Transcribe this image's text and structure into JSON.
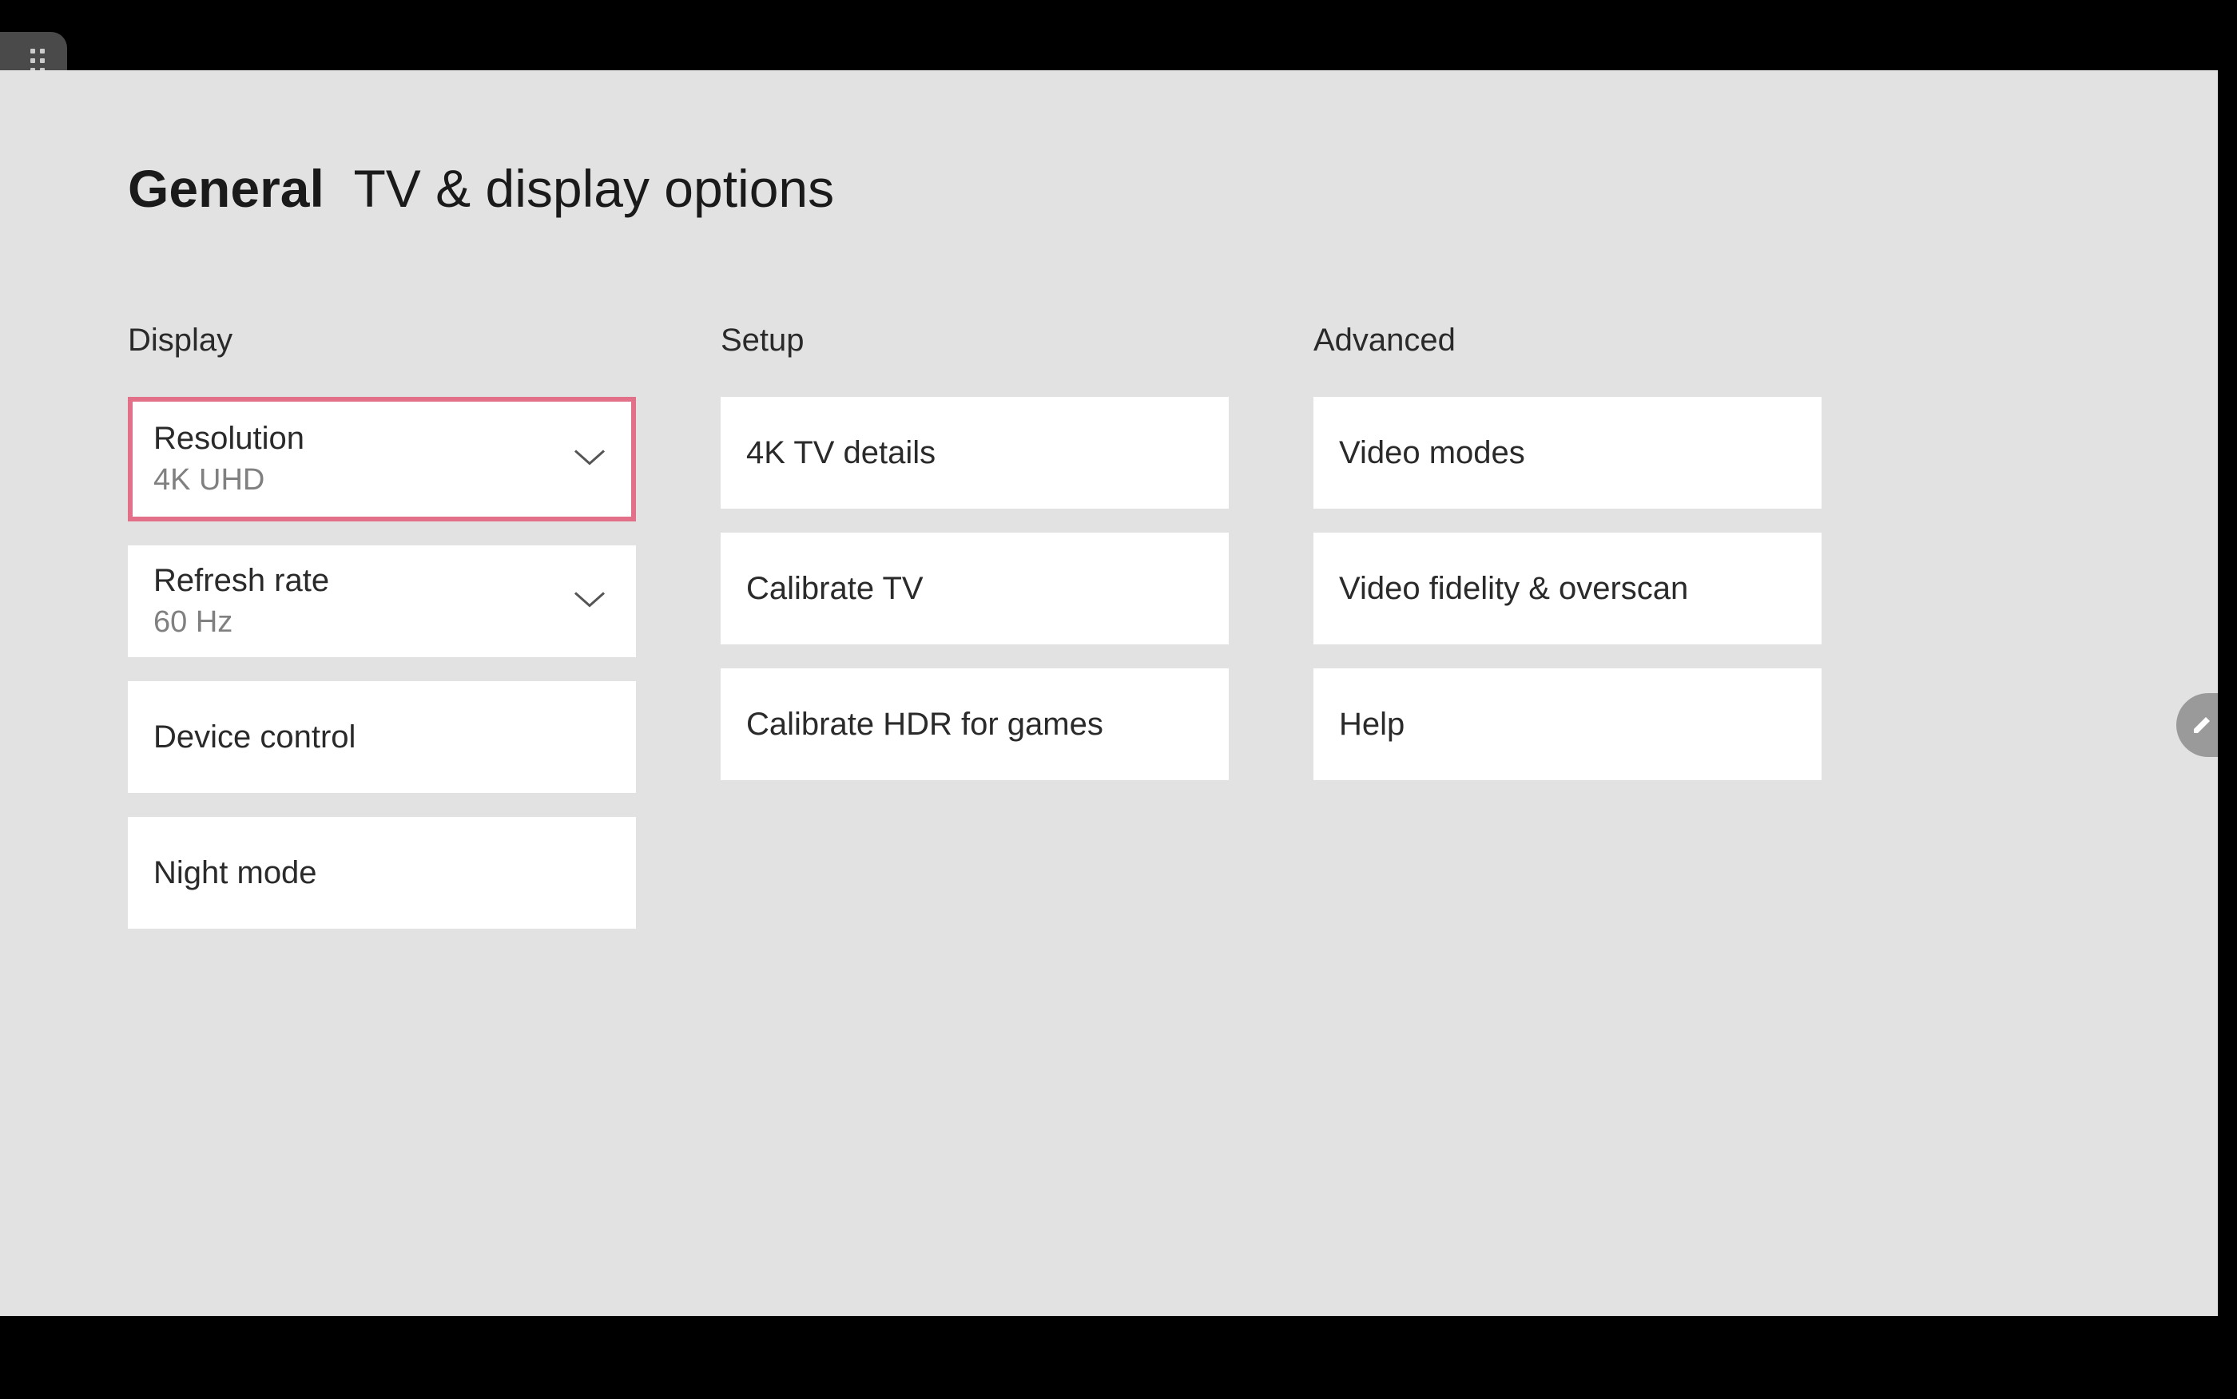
{
  "header": {
    "category": "General",
    "title": "TV & display options"
  },
  "columns": {
    "display": {
      "header": "Display",
      "resolution": {
        "label": "Resolution",
        "value": "4K UHD"
      },
      "refresh_rate": {
        "label": "Refresh rate",
        "value": "60 Hz"
      },
      "device_control": {
        "label": "Device control"
      },
      "night_mode": {
        "label": "Night mode"
      }
    },
    "setup": {
      "header": "Setup",
      "tv_details": {
        "label": "4K TV details"
      },
      "calibrate_tv": {
        "label": "Calibrate TV"
      },
      "calibrate_hdr": {
        "label": "Calibrate HDR for games"
      }
    },
    "advanced": {
      "header": "Advanced",
      "video_modes": {
        "label": "Video modes"
      },
      "video_fidelity": {
        "label": "Video fidelity & overscan"
      },
      "help": {
        "label": "Help"
      }
    }
  }
}
